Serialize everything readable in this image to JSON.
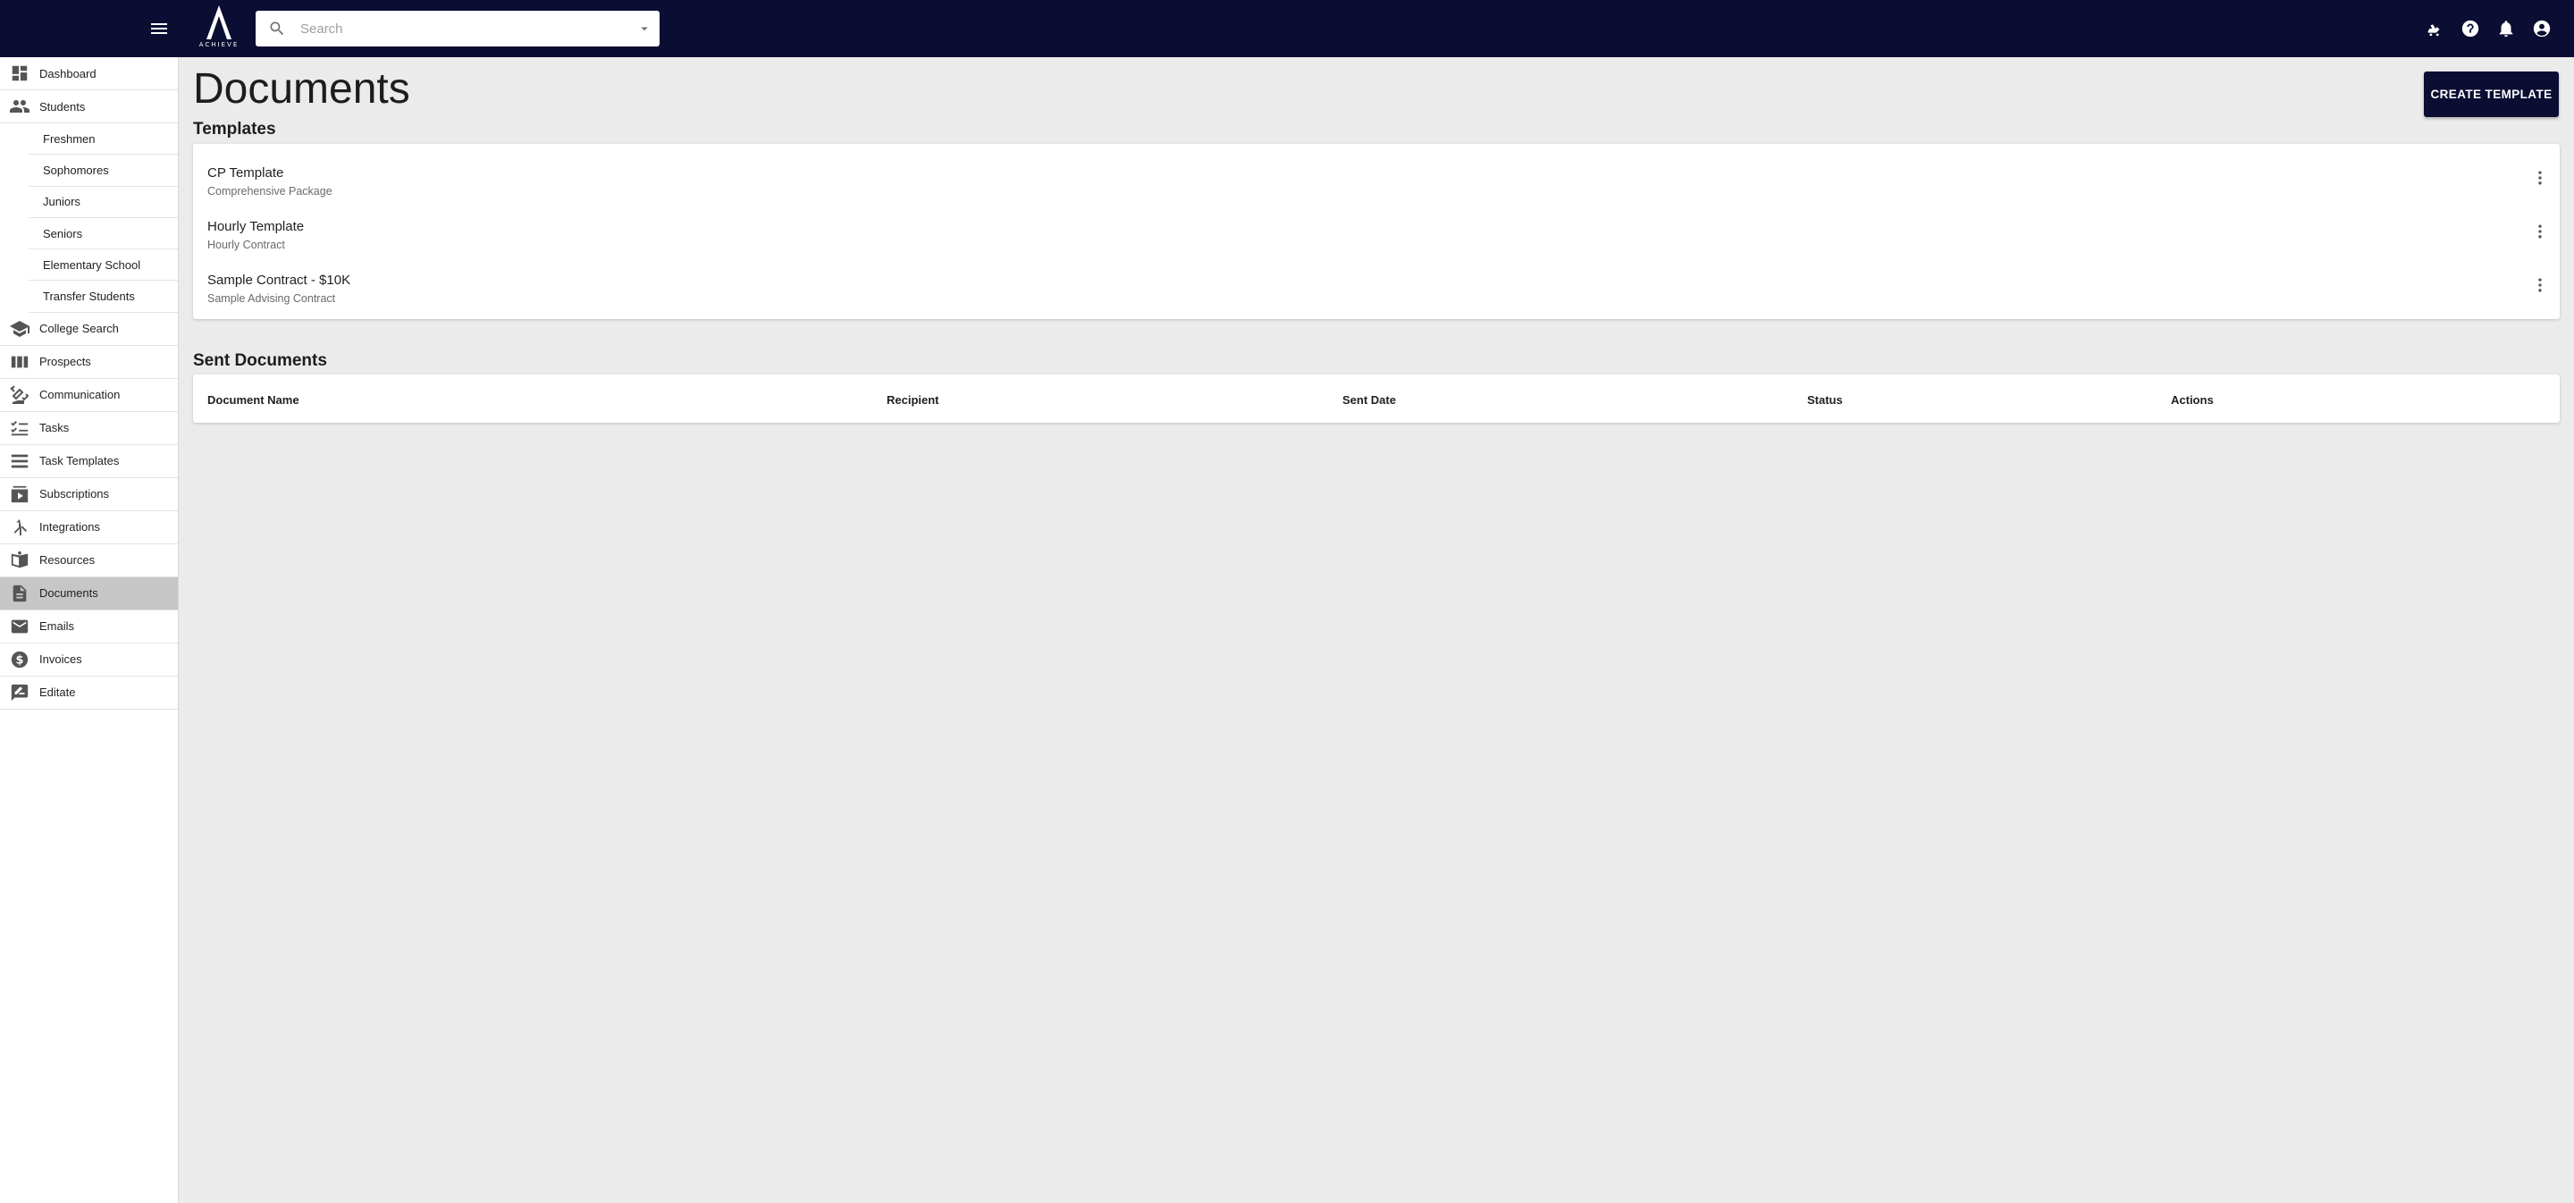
{
  "header": {
    "search_placeholder": "Search",
    "logo_text": "ACHIEVE",
    "icons": [
      "menu-icon",
      "search-icon",
      "chevron-down-icon",
      "skate-icon",
      "help-icon",
      "bell-icon",
      "account-circle-icon"
    ],
    "brand_color": "#0b0d33"
  },
  "sidebar": {
    "items": [
      {
        "label": "Dashboard",
        "icon": "dashboard-icon"
      },
      {
        "label": "Students",
        "icon": "people-icon"
      },
      {
        "label": "College Search",
        "icon": "school-icon"
      },
      {
        "label": "Prospects",
        "icon": "view-week-icon"
      },
      {
        "label": "Communication",
        "icon": "communication-icon"
      },
      {
        "label": "Tasks",
        "icon": "checklist-icon"
      },
      {
        "label": "Task Templates",
        "icon": "list-icon"
      },
      {
        "label": "Subscriptions",
        "icon": "subscriptions-icon"
      },
      {
        "label": "Integrations",
        "icon": "merge-icon"
      },
      {
        "label": "Resources",
        "icon": "resources-icon"
      },
      {
        "label": "Documents",
        "icon": "document-icon"
      },
      {
        "label": "Emails",
        "icon": "mail-icon"
      },
      {
        "label": "Invoices",
        "icon": "dollar-icon"
      },
      {
        "label": "Editate",
        "icon": "rate-review-icon"
      }
    ],
    "student_subitems": [
      "Freshmen",
      "Sophomores",
      "Juniors",
      "Seniors",
      "Elementary School",
      "Transfer Students"
    ],
    "active": "Documents"
  },
  "main": {
    "title": "Documents",
    "create_button": "CREATE TEMPLATE",
    "templates_title": "Templates",
    "templates": [
      {
        "name": "CP Template",
        "subtitle": "Comprehensive Package"
      },
      {
        "name": "Hourly Template",
        "subtitle": "Hourly Contract"
      },
      {
        "name": "Sample Contract - $10K",
        "subtitle": "Sample Advising Contract"
      }
    ],
    "sent_title": "Sent Documents",
    "sent_columns": [
      "Document Name",
      "Recipient",
      "Sent Date",
      "Status",
      "Actions"
    ]
  }
}
